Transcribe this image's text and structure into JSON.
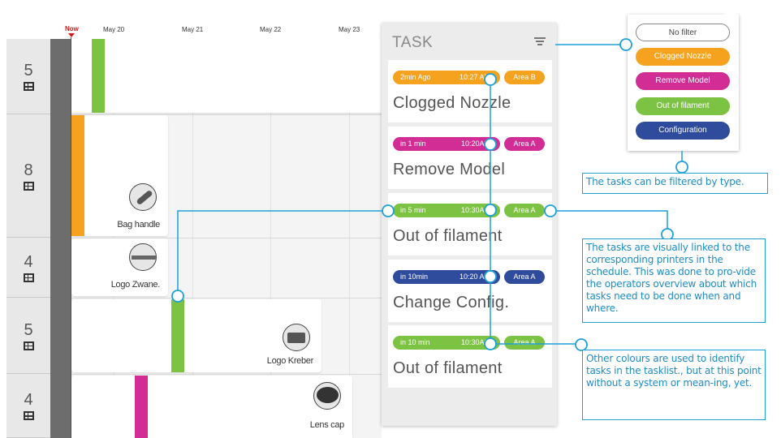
{
  "schedule": {
    "now_label": "Now",
    "dates": [
      "May 20",
      "May 21",
      "May 22",
      "May 23"
    ],
    "rows": [
      {
        "count": "5"
      },
      {
        "count": "8"
      },
      {
        "count": "4"
      },
      {
        "count": "5"
      },
      {
        "count": "4"
      }
    ],
    "jobs": [
      {
        "name": ""
      },
      {
        "name": "Bag handle"
      },
      {
        "name": "Logo Zwane."
      },
      {
        "name": "Logo Kreber"
      },
      {
        "name": "Lens cap"
      }
    ]
  },
  "task_panel": {
    "title": "TASK",
    "filter_icon": "filter-icon",
    "tasks": [
      {
        "relative": "2min Ago",
        "time": "10:27 AM",
        "area": "Area B",
        "name": "Clogged Nozzle",
        "color": "#f5a21e"
      },
      {
        "relative": "in 1 min",
        "time": "10:20AM",
        "area": "Area A",
        "name": "Remove Model",
        "color": "#d12d94"
      },
      {
        "relative": "in 5 min",
        "time": "10:30AM",
        "area": "Area A",
        "name": "Out of filament",
        "color": "#7cc243"
      },
      {
        "relative": "in 10min",
        "time": "10:20 AM",
        "area": "Area A",
        "name": "Change Config.",
        "color": "#2f4b9c"
      },
      {
        "relative": "in 10 min",
        "time": "10:30AM",
        "area": "Area A",
        "name": "Out of filament",
        "color": "#7cc243"
      }
    ]
  },
  "filter_popup": {
    "options": [
      {
        "label": "No filter",
        "color": "#ffffff"
      },
      {
        "label": "Clogged Nozzle",
        "color": "#f5a21e"
      },
      {
        "label": "Remove Model",
        "color": "#d12d94"
      },
      {
        "label": "Out of filament",
        "color": "#7cc243"
      },
      {
        "label": "Configuration",
        "color": "#2f4b9c"
      }
    ]
  },
  "annotations": {
    "filter_note": "The tasks can be filtered by type.",
    "link_note": "The tasks are visually linked to the corresponding printers in the schedule. This was done to pro-vide the operators overview about which tasks need to be done when and where.",
    "colour_note": "Other colours are used to identify tasks in the tasklist., but at this point without a system or mean-ing, yet."
  },
  "colors": {
    "accent_line": "#1ea0d8",
    "now_marker": "#d01a1a",
    "orange": "#f5a21e",
    "magenta": "#d12d94",
    "green": "#7cc243",
    "navy": "#2f4b9c"
  }
}
